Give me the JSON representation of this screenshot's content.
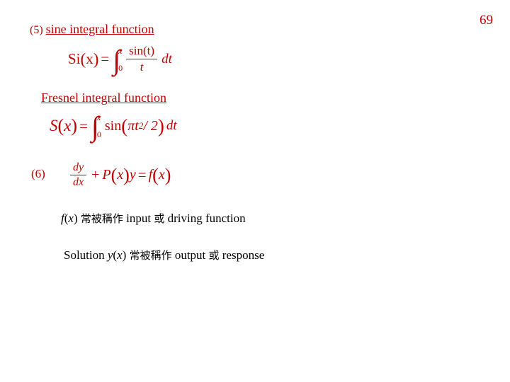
{
  "page": {
    "number": "69"
  },
  "item5": {
    "number": "(5)",
    "title": "sine integral function"
  },
  "formula_si": {
    "lhs_name": "Si",
    "lhs_open": "(",
    "lhs_var": "x",
    "lhs_close": ")",
    "equals": "=",
    "integral_upper": "x",
    "integral_lower": "0",
    "numerator": "sin(t)",
    "denominator": "t",
    "differential": "dt"
  },
  "fresnel": {
    "title": "Fresnel integral function"
  },
  "formula_fresnel": {
    "lhs_name": "S",
    "lhs_open": "(",
    "lhs_var": "x",
    "lhs_close": ")",
    "equals": "=",
    "integral_upper": "x",
    "integral_lower": "0",
    "func": "sin",
    "arg_open": "(",
    "arg_pi": "π",
    "arg_var": "t",
    "arg_exp": "2",
    "arg_div": " / 2",
    "arg_close": ")",
    "differential": "dt"
  },
  "item6": {
    "number": "(6)"
  },
  "formula_ode": {
    "frac_numer": "dy",
    "frac_denom": "dx",
    "plus": "+",
    "p_name": "P",
    "p_open": "(",
    "p_var": "x",
    "p_close": ")",
    "y": "y",
    "equals": "=",
    "f_name": "f",
    "f_open": "(",
    "f_var": "x",
    "f_close": ")"
  },
  "notes": {
    "line1_fx": "f",
    "line1_open": "(",
    "line1_var": "x",
    "line1_close": ")",
    "line1_cjk": "常被稱作",
    "line1_input": "input",
    "line1_or": "或",
    "line1_driving": "driving function",
    "line2_solution": "Solution ",
    "line2_y": "y",
    "line2_open": "(",
    "line2_var": "x",
    "line2_close": ")",
    "line2_cjk": "常被稱作",
    "line2_output": "output",
    "line2_or": "或",
    "line2_response": "response"
  },
  "colors": {
    "accent": "#C00000",
    "text": "#000000",
    "background": "#FFFFFF"
  }
}
